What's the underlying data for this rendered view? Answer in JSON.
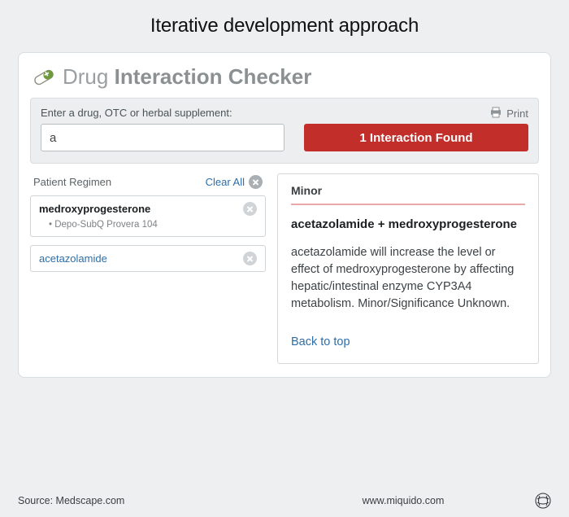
{
  "page_title": "Iterative development approach",
  "app": {
    "title_first": "Drug",
    "title_rest": "Interaction Checker"
  },
  "search": {
    "label": "Enter a drug, OTC or herbal supplement:",
    "value": "a",
    "print_label": "Print"
  },
  "found_button": "1 Interaction Found",
  "regimen": {
    "title": "Patient Regimen",
    "clear_all": "Clear All",
    "items": [
      {
        "name": "medroxyprogesterone",
        "sub": "Depo-SubQ Provera 104",
        "link": false
      },
      {
        "name": "acetazolamide",
        "sub": null,
        "link": true
      }
    ]
  },
  "detail": {
    "severity": "Minor",
    "combo": "acetazolamide + medroxyprogesterone",
    "description": "acetazolamide will increase the level or effect of medroxyprogesterone by affecting hepatic/intestinal enzyme CYP3A4 metabolism. Minor/Significance Unknown.",
    "back_to_top": "Back to top"
  },
  "footer": {
    "source": "Source: Medscape.com",
    "site": "www.miquido.com"
  }
}
